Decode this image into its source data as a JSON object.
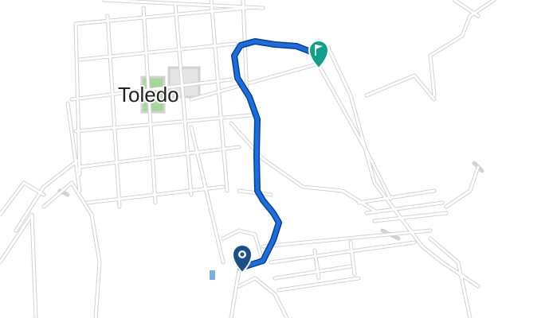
{
  "map": {
    "place_label": "Toledo",
    "route": {
      "color": "#1a6fe0",
      "casing": "#0b3f94"
    },
    "start_marker": {
      "icon": "start-location-pin-icon",
      "color": "#1a4f8a"
    },
    "end_marker": {
      "icon": "finish-flag-pin-icon",
      "color": "#13a08a"
    },
    "park_color": "#a8d69a",
    "plaza_color": "#e5e5e5",
    "water_color": "#7aaee8"
  }
}
